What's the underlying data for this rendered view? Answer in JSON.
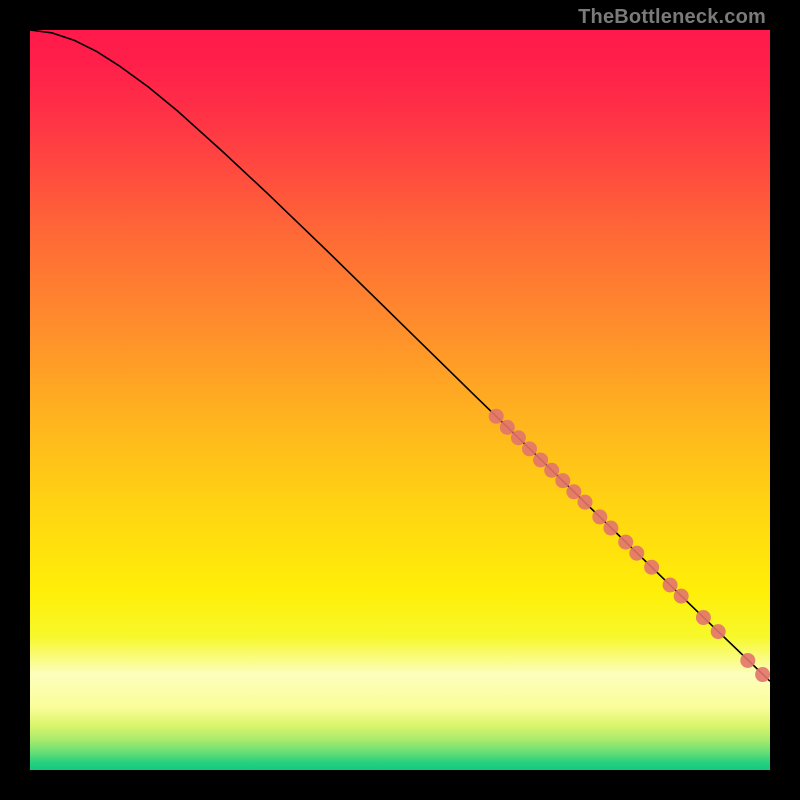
{
  "watermark": "TheBottleneck.com",
  "chart_data": {
    "type": "line",
    "title": "",
    "xlabel": "",
    "ylabel": "",
    "xlim": [
      0,
      100
    ],
    "ylim": [
      0,
      100
    ],
    "background_gradient": {
      "stops": [
        {
          "offset": 0.0,
          "color": "#ff1a4b"
        },
        {
          "offset": 0.04,
          "color": "#ff1e4a"
        },
        {
          "offset": 0.1,
          "color": "#ff2d47"
        },
        {
          "offset": 0.18,
          "color": "#ff4740"
        },
        {
          "offset": 0.28,
          "color": "#ff6a36"
        },
        {
          "offset": 0.4,
          "color": "#ff8d2c"
        },
        {
          "offset": 0.52,
          "color": "#ffb21f"
        },
        {
          "offset": 0.64,
          "color": "#ffd312"
        },
        {
          "offset": 0.76,
          "color": "#ffef08"
        },
        {
          "offset": 0.82,
          "color": "#f7f82b"
        },
        {
          "offset": 0.87,
          "color": "#fcfebc"
        },
        {
          "offset": 0.915,
          "color": "#fbfd9a"
        },
        {
          "offset": 0.94,
          "color": "#d9f56a"
        },
        {
          "offset": 0.96,
          "color": "#a6ea6d"
        },
        {
          "offset": 0.977,
          "color": "#63dd77"
        },
        {
          "offset": 0.99,
          "color": "#26d07f"
        },
        {
          "offset": 1.0,
          "color": "#13cb83"
        }
      ]
    },
    "series": [
      {
        "name": "curve",
        "type": "line",
        "color": "#000000",
        "points": [
          {
            "x": 0.0,
            "y": 100.0
          },
          {
            "x": 3.0,
            "y": 99.6
          },
          {
            "x": 6.0,
            "y": 98.6
          },
          {
            "x": 9.0,
            "y": 97.1
          },
          {
            "x": 12.0,
            "y": 95.2
          },
          {
            "x": 16.0,
            "y": 92.3
          },
          {
            "x": 20.0,
            "y": 89.0
          },
          {
            "x": 26.0,
            "y": 83.6
          },
          {
            "x": 32.0,
            "y": 78.0
          },
          {
            "x": 40.0,
            "y": 70.3
          },
          {
            "x": 50.0,
            "y": 60.5
          },
          {
            "x": 60.0,
            "y": 50.7
          },
          {
            "x": 70.0,
            "y": 41.0
          },
          {
            "x": 80.0,
            "y": 31.3
          },
          {
            "x": 90.0,
            "y": 21.6
          },
          {
            "x": 100.0,
            "y": 12.0
          }
        ]
      },
      {
        "name": "markers",
        "type": "scatter",
        "color": "#e2746c",
        "points": [
          {
            "x": 63.0,
            "y": 47.8
          },
          {
            "x": 64.5,
            "y": 46.3
          },
          {
            "x": 66.0,
            "y": 44.9
          },
          {
            "x": 67.5,
            "y": 43.4
          },
          {
            "x": 69.0,
            "y": 41.9
          },
          {
            "x": 70.5,
            "y": 40.5
          },
          {
            "x": 72.0,
            "y": 39.1
          },
          {
            "x": 73.5,
            "y": 37.6
          },
          {
            "x": 75.0,
            "y": 36.2
          },
          {
            "x": 77.0,
            "y": 34.2
          },
          {
            "x": 78.5,
            "y": 32.7
          },
          {
            "x": 80.5,
            "y": 30.8
          },
          {
            "x": 82.0,
            "y": 29.3
          },
          {
            "x": 84.0,
            "y": 27.4
          },
          {
            "x": 86.5,
            "y": 25.0
          },
          {
            "x": 88.0,
            "y": 23.5
          },
          {
            "x": 91.0,
            "y": 20.6
          },
          {
            "x": 93.0,
            "y": 18.7
          },
          {
            "x": 97.0,
            "y": 14.8
          },
          {
            "x": 99.0,
            "y": 12.9
          }
        ]
      }
    ]
  }
}
